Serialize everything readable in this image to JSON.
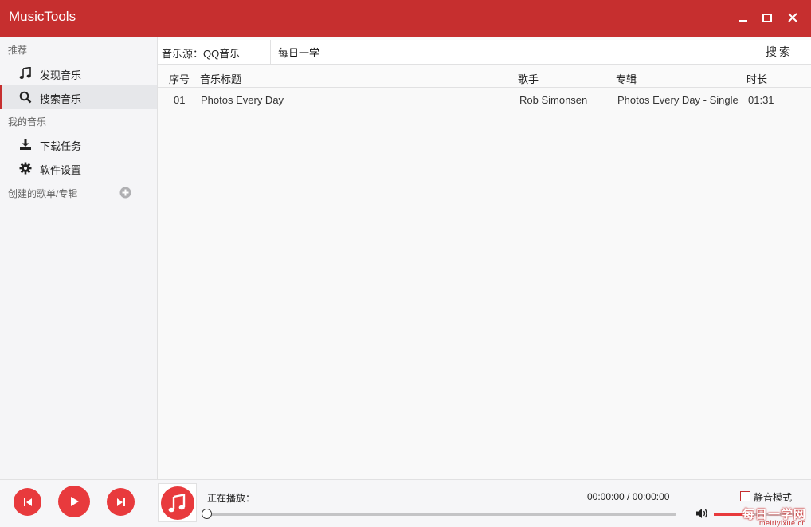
{
  "window": {
    "title": "MusicTools",
    "controls": {
      "minimize_icon": "minimize-icon",
      "maximize_icon": "maximize-icon",
      "close_icon": "close-icon"
    }
  },
  "sidebar": {
    "section_recommend": "推荐",
    "items": [
      {
        "label": "发现音乐",
        "icon": "music-note-icon",
        "active": false
      },
      {
        "label": "搜索音乐",
        "icon": "search-icon",
        "active": true
      }
    ],
    "section_my_music": "我的音乐",
    "my_items": [
      {
        "label": "下载任务",
        "icon": "download-icon"
      },
      {
        "label": "软件设置",
        "icon": "gear-icon"
      }
    ],
    "section_playlists": "创建的歌单/专辑",
    "add_icon": "add-circle-icon"
  },
  "search": {
    "source_label": "音乐源：QQ音乐",
    "query": "每日一学",
    "button_label": "搜索"
  },
  "table": {
    "headers": {
      "index": "序号",
      "title": "音乐标题",
      "artist": "歌手",
      "album": "专辑",
      "duration": "时长"
    },
    "rows": [
      {
        "index": "01",
        "title": "Photos Every Day",
        "artist": "Rob Simonsen",
        "album": "Photos Every Day - Single",
        "duration": "01:31"
      }
    ]
  },
  "player": {
    "prev_icon": "previous-icon",
    "play_icon": "play-icon",
    "next_icon": "next-icon",
    "album_icon": "music-note-icon",
    "now_playing_label": "正在播放：",
    "time": "00:00:00 / 00:00:00",
    "progress": 0,
    "mute_label": "静音模式",
    "mute_checked": false,
    "volume_icon": "volume-icon",
    "volume": 0.45
  },
  "watermark": {
    "main": "每日一学网",
    "sub": "meiriyixue.cn"
  },
  "colors": {
    "accent": "#c62f2f",
    "button": "#e83a3d"
  }
}
